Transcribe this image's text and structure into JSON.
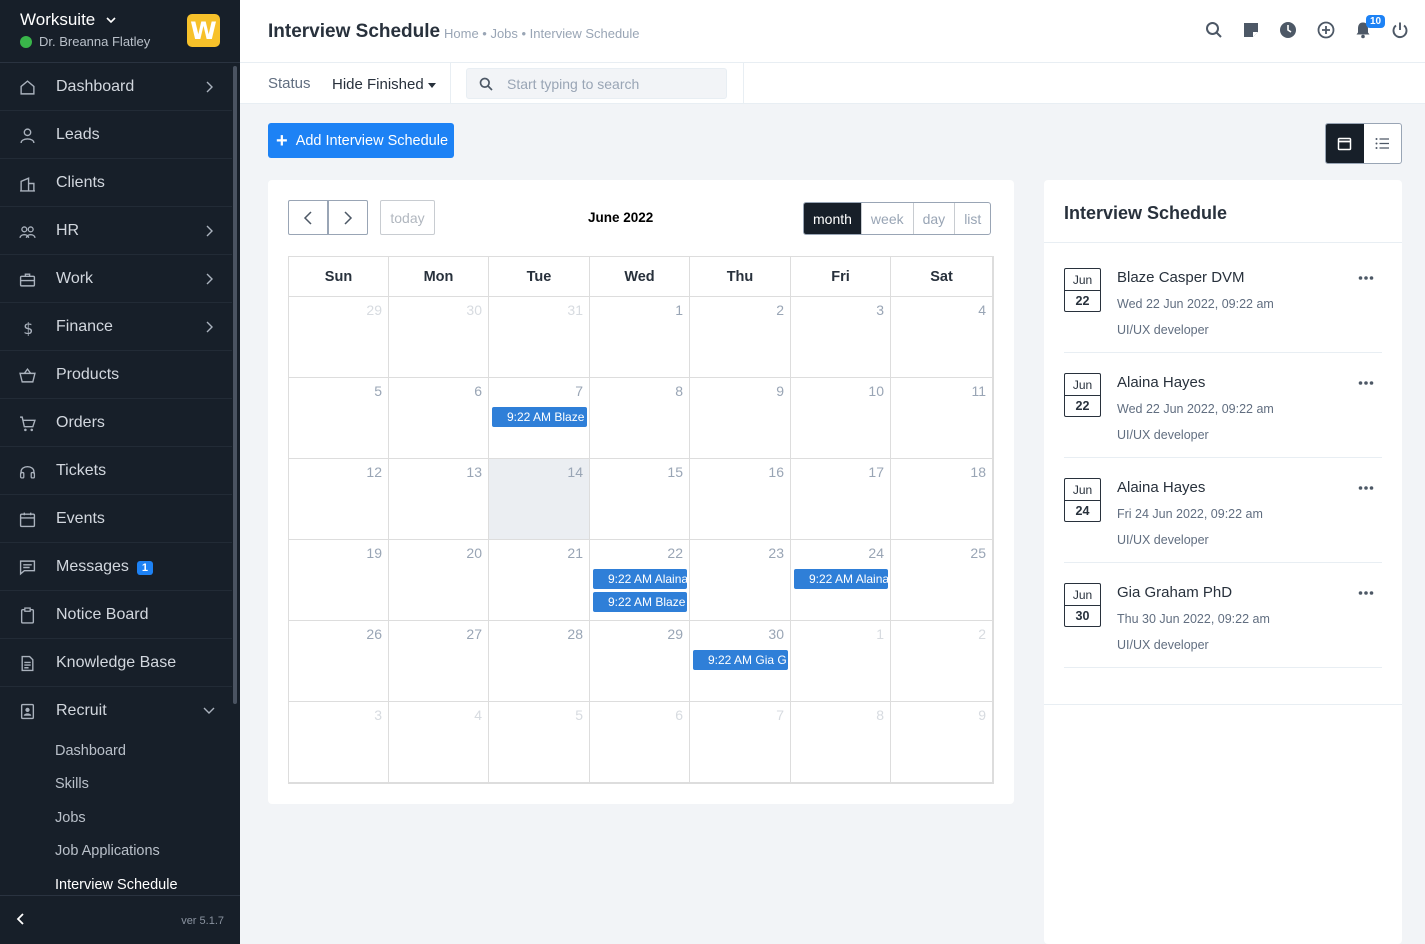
{
  "sidebar": {
    "company": "Worksuite",
    "user": "Dr. Breanna Flatley",
    "logo_letter": "W",
    "items": [
      {
        "label": "Dashboard",
        "icon": "home-icon"
      },
      {
        "label": "Leads",
        "icon": "person-icon"
      },
      {
        "label": "Clients",
        "icon": "building-icon"
      },
      {
        "label": "HR",
        "icon": "people-icon"
      },
      {
        "label": "Work",
        "icon": "briefcase-icon"
      },
      {
        "label": "Finance",
        "icon": "dollar-icon"
      },
      {
        "label": "Products",
        "icon": "basket-icon"
      },
      {
        "label": "Orders",
        "icon": "cart-icon"
      },
      {
        "label": "Tickets",
        "icon": "headset-icon"
      },
      {
        "label": "Events",
        "icon": "calendar-icon"
      },
      {
        "label": "Messages",
        "icon": "message-icon",
        "badge": "1"
      },
      {
        "label": "Notice Board",
        "icon": "clipboard-icon"
      },
      {
        "label": "Knowledge Base",
        "icon": "document-icon"
      },
      {
        "label": "Recruit",
        "icon": "badge-icon"
      }
    ],
    "sub_items": [
      "Dashboard",
      "Skills",
      "Jobs",
      "Job Applications",
      "Interview Schedule"
    ],
    "version": "ver 5.1.7"
  },
  "header": {
    "title": "Interview Schedule",
    "breadcrumb": "Home • Jobs • Interview Schedule",
    "notification_count": "10"
  },
  "filters": {
    "status_label": "Status",
    "status_value": "Hide Finished",
    "search_placeholder": "Start typing to search"
  },
  "actions": {
    "add_label": "Add Interview Schedule"
  },
  "calendar": {
    "title": "June 2022",
    "today_label": "today",
    "views": [
      "month",
      "week",
      "day",
      "list"
    ],
    "active_view": "month",
    "weekdays": [
      "Sun",
      "Mon",
      "Tue",
      "Wed",
      "Thu",
      "Fri",
      "Sat"
    ],
    "weeks": [
      [
        {
          "d": "29",
          "m": true
        },
        {
          "d": "30",
          "m": true
        },
        {
          "d": "31",
          "m": true
        },
        {
          "d": "1"
        },
        {
          "d": "2"
        },
        {
          "d": "3"
        },
        {
          "d": "4"
        }
      ],
      [
        {
          "d": "5"
        },
        {
          "d": "6"
        },
        {
          "d": "7",
          "events": [
            "9:22 AM Blaze"
          ]
        },
        {
          "d": "8"
        },
        {
          "d": "9"
        },
        {
          "d": "10"
        },
        {
          "d": "11"
        }
      ],
      [
        {
          "d": "12"
        },
        {
          "d": "13"
        },
        {
          "d": "14",
          "today": true
        },
        {
          "d": "15"
        },
        {
          "d": "16"
        },
        {
          "d": "17"
        },
        {
          "d": "18"
        }
      ],
      [
        {
          "d": "19"
        },
        {
          "d": "20"
        },
        {
          "d": "21"
        },
        {
          "d": "22",
          "events": [
            "9:22 AM Alaina",
            "9:22 AM Blaze"
          ]
        },
        {
          "d": "23"
        },
        {
          "d": "24",
          "events": [
            "9:22 AM Alaina"
          ]
        },
        {
          "d": "25"
        }
      ],
      [
        {
          "d": "26"
        },
        {
          "d": "27"
        },
        {
          "d": "28"
        },
        {
          "d": "29"
        },
        {
          "d": "30",
          "events": [
            "9:22 AM Gia G"
          ]
        },
        {
          "d": "1",
          "m": true
        },
        {
          "d": "2",
          "m": true
        }
      ],
      [
        {
          "d": "3",
          "m": true
        },
        {
          "d": "4",
          "m": true
        },
        {
          "d": "5",
          "m": true
        },
        {
          "d": "6",
          "m": true
        },
        {
          "d": "7",
          "m": true
        },
        {
          "d": "8",
          "m": true
        },
        {
          "d": "9",
          "m": true
        }
      ]
    ]
  },
  "schedule": {
    "title": "Interview Schedule",
    "items": [
      {
        "month": "Jun",
        "day": "22",
        "name": "Blaze Casper DVM",
        "date": "Wed 22 Jun 2022, 09:22 am",
        "job": "UI/UX developer"
      },
      {
        "month": "Jun",
        "day": "22",
        "name": "Alaina Hayes",
        "date": "Wed 22 Jun 2022, 09:22 am",
        "job": "UI/UX developer"
      },
      {
        "month": "Jun",
        "day": "24",
        "name": "Alaina Hayes",
        "date": "Fri 24 Jun 2022, 09:22 am",
        "job": "UI/UX developer"
      },
      {
        "month": "Jun",
        "day": "30",
        "name": "Gia Graham PhD",
        "date": "Thu 30 Jun 2022, 09:22 am",
        "job": "UI/UX developer"
      }
    ]
  },
  "colors": {
    "sidebar_bg": "#171f29",
    "accent": "#1d82f5",
    "event": "#2f7fd8",
    "logo": "#f7c12a",
    "online": "#39b54a"
  }
}
